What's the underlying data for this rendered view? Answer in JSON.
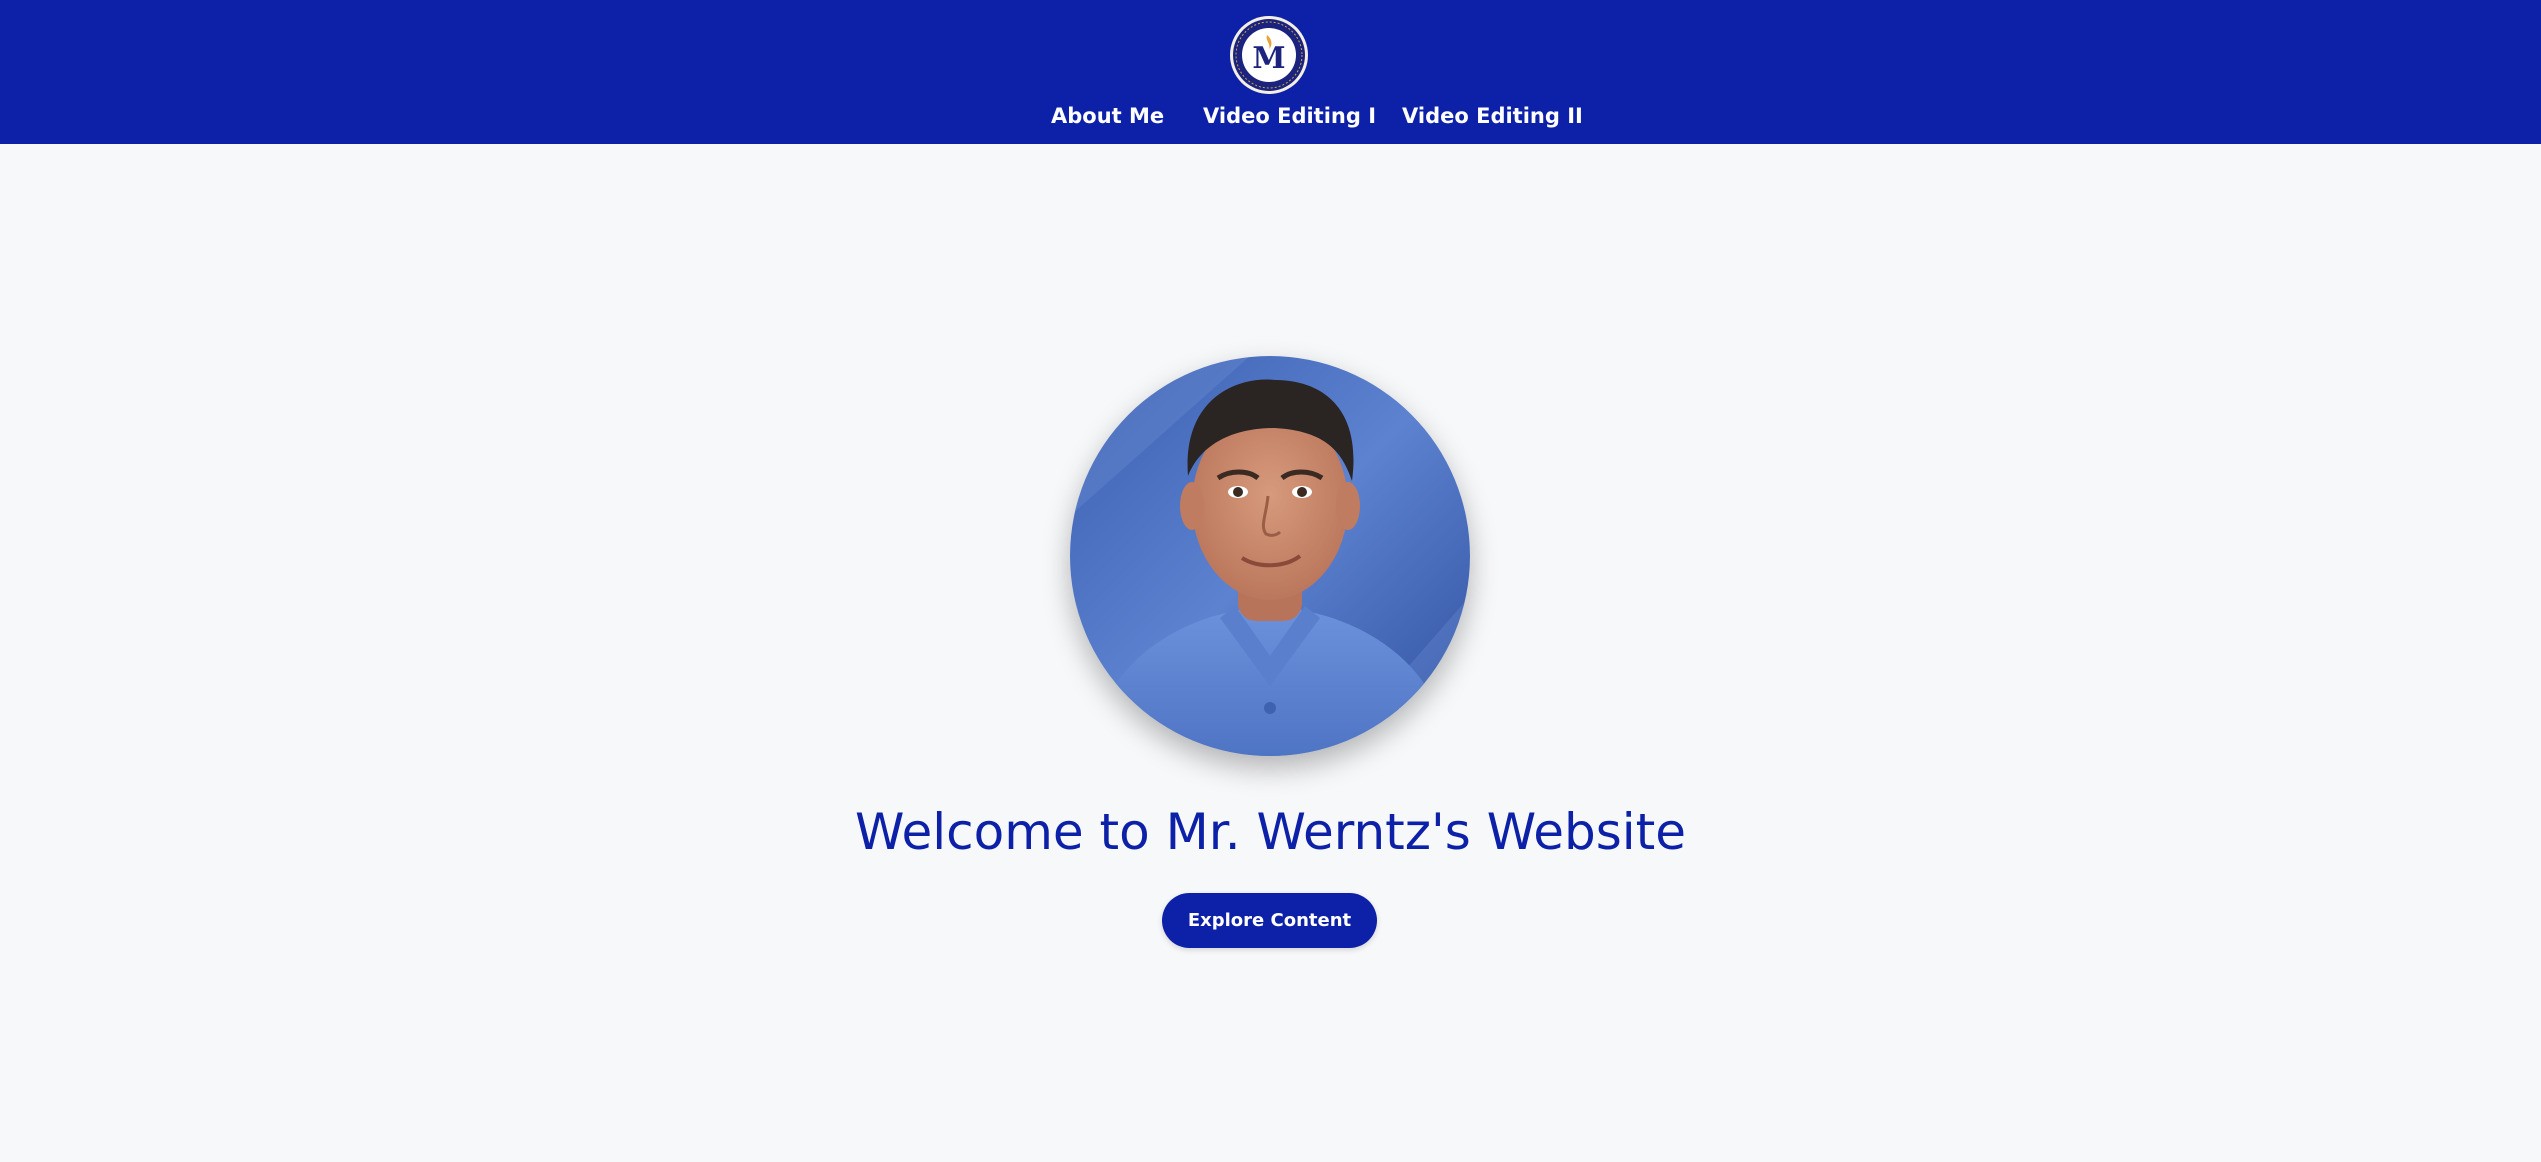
{
  "header": {
    "logo": {
      "icon": "school-crest-m-icon",
      "letter": "M"
    },
    "nav": [
      {
        "label": "About Me"
      },
      {
        "label": "Video Editing I"
      },
      {
        "label": "Video Editing II"
      }
    ]
  },
  "hero": {
    "portrait": {
      "icon": "teacher-portrait"
    },
    "title": "Welcome to Mr. Werntz's Website",
    "cta_label": "Explore Content"
  },
  "colors": {
    "brand_blue": "#0d21a8",
    "page_background": "#f7f8fa",
    "nav_text": "#ffffff"
  }
}
